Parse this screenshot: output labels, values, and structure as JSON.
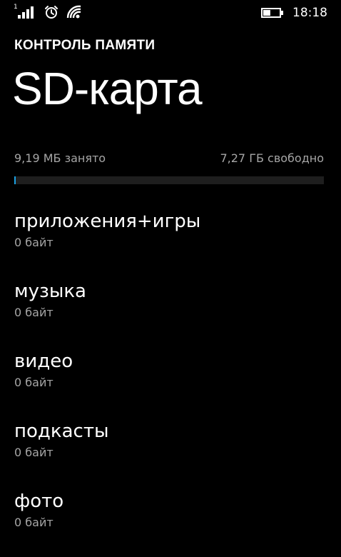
{
  "status_bar": {
    "sim_indicator": "1",
    "icons": [
      "signal-icon",
      "alarm-icon",
      "wifi-icon",
      "battery-icon"
    ],
    "battery_level": 0.45,
    "time": "18:18"
  },
  "header": {
    "app_title": "КОНТРОЛЬ ПАМЯТИ",
    "page_title": "SD-карта"
  },
  "usage": {
    "used_label": "9,19 МБ занято",
    "free_label": "7,27 ГБ свободно",
    "used_fraction": 0.001,
    "fill_color": "#1ba1e2"
  },
  "categories": [
    {
      "name": "приложения+игры",
      "size": "0 байт"
    },
    {
      "name": "музыка",
      "size": "0 байт"
    },
    {
      "name": "видео",
      "size": "0 байт"
    },
    {
      "name": "подкасты",
      "size": "0 байт"
    },
    {
      "name": "фото",
      "size": "0 байт"
    }
  ],
  "colors": {
    "background": "#000000",
    "text_primary": "#ffffff",
    "text_secondary": "#a6a6a6",
    "accent": "#1ba1e2"
  }
}
